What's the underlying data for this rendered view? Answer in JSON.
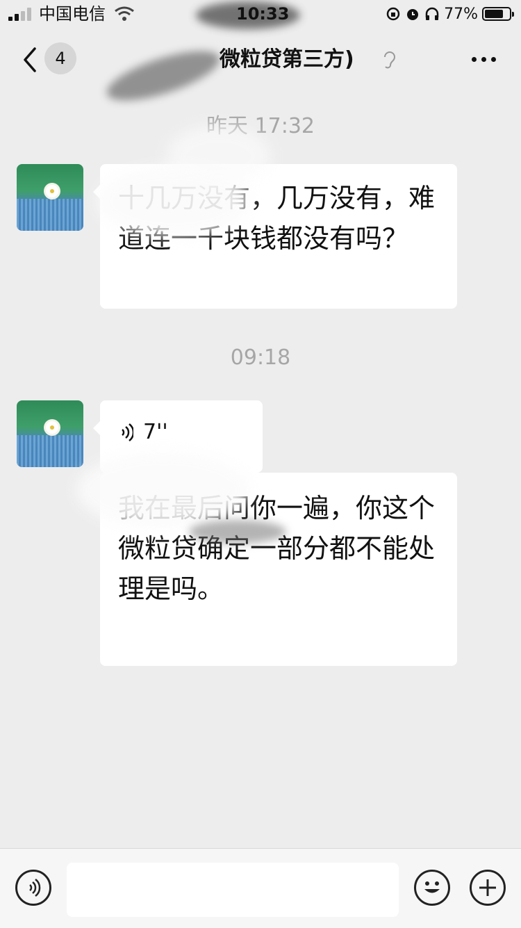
{
  "status_bar": {
    "carrier": "中国电信",
    "time": "10:33",
    "battery_percent": "77%",
    "battery_level": 0.77,
    "icons": [
      "signal-icon",
      "wifi-icon",
      "rotation-lock-icon",
      "alarm-icon",
      "headphones-icon",
      "battery-icon"
    ]
  },
  "nav": {
    "back_icon": "chevron-left-icon",
    "unread_count": "4",
    "title": "微粒贷第三方)",
    "title_icon": "ear-icon",
    "more_icon": "more-icon"
  },
  "messages": [
    {
      "timestamp": "昨天 17:32"
    },
    {
      "type": "text",
      "text": "十几万没有，几万没有，难道连一千块钱都没有吗？"
    },
    {
      "timestamp": "09:18"
    },
    {
      "type": "voice",
      "duration": "7''",
      "icon": "voice-wave-icon"
    },
    {
      "type": "text",
      "text": "我在最后问你一遍，你这个微粒贷确定一部分都不能处理是吗。"
    }
  ],
  "bottom_bar": {
    "voice_button_icon": "voice-input-icon",
    "input_value": "",
    "emoji_icon": "emoji-icon",
    "plus_icon": "plus-icon"
  },
  "colors": {
    "background": "#ededed",
    "bubble": "#ffffff",
    "timestamp": "#a6a6a6"
  }
}
